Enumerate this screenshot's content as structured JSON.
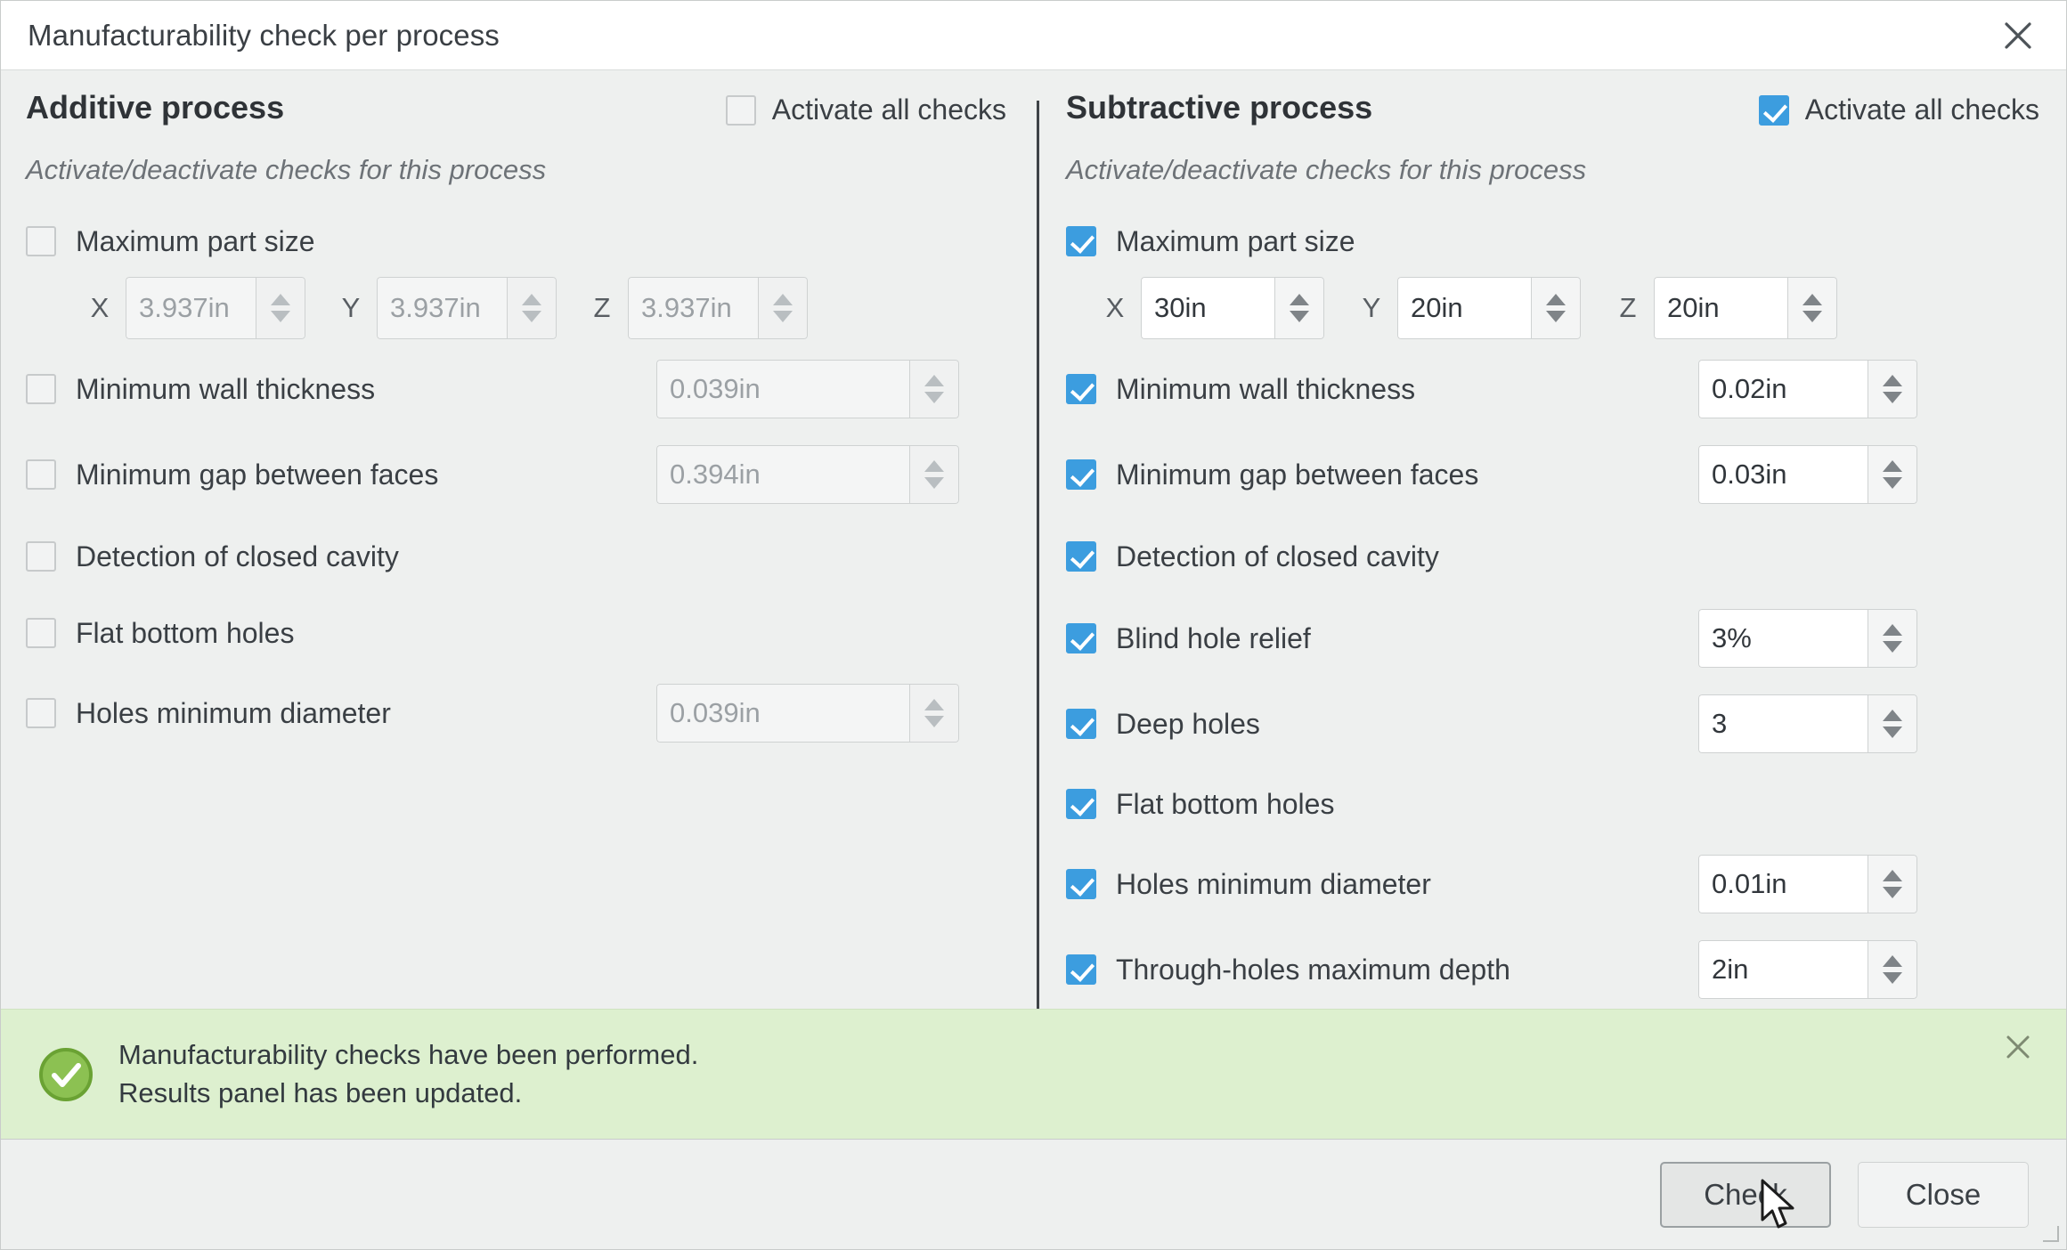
{
  "window": {
    "title": "Manufacturability check per process",
    "close_icon": "close-icon"
  },
  "additive": {
    "title": "Additive process",
    "subtitle": "Activate/deactivate checks for this process",
    "activate_all_label": "Activate all checks",
    "activate_all_checked": false,
    "max_part_size": {
      "label": "Maximum part size",
      "checked": false,
      "enabled": false,
      "axes": [
        {
          "letter": "X",
          "value": "3.937in"
        },
        {
          "letter": "Y",
          "value": "3.937in"
        },
        {
          "letter": "Z",
          "value": "3.937in"
        }
      ]
    },
    "checks": [
      {
        "label": "Minimum wall thickness",
        "checked": false,
        "value": "0.039in",
        "has_field": true
      },
      {
        "label": "Minimum gap between faces",
        "checked": false,
        "value": "0.394in",
        "has_field": true
      },
      {
        "label": "Detection of closed cavity",
        "checked": false,
        "value": "",
        "has_field": false
      },
      {
        "label": "Flat bottom holes",
        "checked": false,
        "value": "",
        "has_field": false
      },
      {
        "label": "Holes minimum diameter",
        "checked": false,
        "value": "0.039in",
        "has_field": true
      }
    ]
  },
  "subtractive": {
    "title": "Subtractive process",
    "subtitle": "Activate/deactivate checks for this process",
    "activate_all_label": "Activate all checks",
    "activate_all_checked": true,
    "max_part_size": {
      "label": "Maximum part size",
      "checked": true,
      "enabled": true,
      "axes": [
        {
          "letter": "X",
          "value": "30in"
        },
        {
          "letter": "Y",
          "value": "20in"
        },
        {
          "letter": "Z",
          "value": "20in"
        }
      ]
    },
    "checks": [
      {
        "label": "Minimum wall thickness",
        "checked": true,
        "value": "0.02in",
        "has_field": true
      },
      {
        "label": "Minimum gap between faces",
        "checked": true,
        "value": "0.03in",
        "has_field": true
      },
      {
        "label": "Detection of closed cavity",
        "checked": true,
        "value": "",
        "has_field": false
      },
      {
        "label": "Blind hole relief",
        "checked": true,
        "value": "3%",
        "has_field": true
      },
      {
        "label": "Deep holes",
        "checked": true,
        "value": "3",
        "has_field": true
      },
      {
        "label": "Flat bottom holes",
        "checked": true,
        "value": "",
        "has_field": false
      },
      {
        "label": "Holes minimum diameter",
        "checked": true,
        "value": "0.01in",
        "has_field": true
      },
      {
        "label": "Through-holes maximum depth",
        "checked": true,
        "value": "2in",
        "has_field": true
      }
    ]
  },
  "banner": {
    "icon": "success-check-icon",
    "line1": "Manufacturability checks have been performed.",
    "line2": "Results panel has been updated.",
    "close_icon": "close-icon",
    "background_color": "#ddf0cf"
  },
  "footer": {
    "check_label": "Check",
    "close_label": "Close"
  },
  "colors": {
    "accent_checkbox": "#3c9ddf",
    "banner_bg": "#ddf0cf",
    "banner_icon": "#7ab648",
    "dialog_bg": "#eef0ef"
  }
}
